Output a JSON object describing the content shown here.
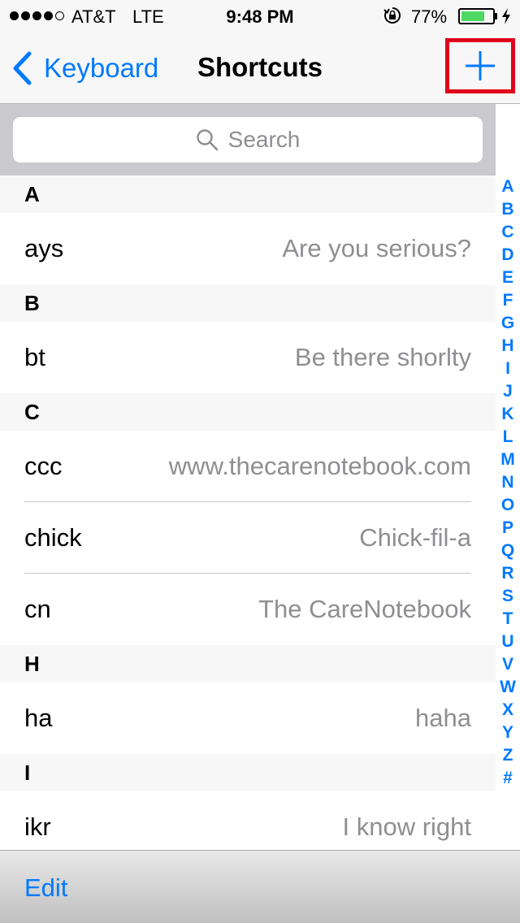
{
  "status_bar": {
    "carrier": "AT&T",
    "network": "LTE",
    "time": "9:48 PM",
    "battery_percent": "77%",
    "battery_level": 0.77,
    "battery_color": "#4cd964"
  },
  "nav_bar": {
    "back_label": "Keyboard",
    "title": "Shortcuts",
    "add_icon": "plus-icon",
    "accent_color": "#0079ff"
  },
  "search": {
    "placeholder": "Search"
  },
  "sections": [
    {
      "letter": "A",
      "items": [
        {
          "shortcut": "ays",
          "phrase": "Are you serious?"
        }
      ]
    },
    {
      "letter": "B",
      "items": [
        {
          "shortcut": "bt",
          "phrase": "Be there shorlty"
        }
      ]
    },
    {
      "letter": "C",
      "items": [
        {
          "shortcut": "ccc",
          "phrase": "www.thecarenotebook.com"
        },
        {
          "shortcut": "chick",
          "phrase": "Chick-fil-a"
        },
        {
          "shortcut": "cn",
          "phrase": "The CareNotebook"
        }
      ]
    },
    {
      "letter": "H",
      "items": [
        {
          "shortcut": "ha",
          "phrase": "haha"
        }
      ]
    },
    {
      "letter": "I",
      "items": [
        {
          "shortcut": "ikr",
          "phrase": "I know right"
        }
      ]
    }
  ],
  "index_letters": [
    "A",
    "B",
    "C",
    "D",
    "E",
    "F",
    "G",
    "H",
    "I",
    "J",
    "K",
    "L",
    "M",
    "N",
    "O",
    "P",
    "Q",
    "R",
    "S",
    "T",
    "U",
    "V",
    "W",
    "X",
    "Y",
    "Z",
    "#"
  ],
  "toolbar": {
    "edit_label": "Edit"
  }
}
